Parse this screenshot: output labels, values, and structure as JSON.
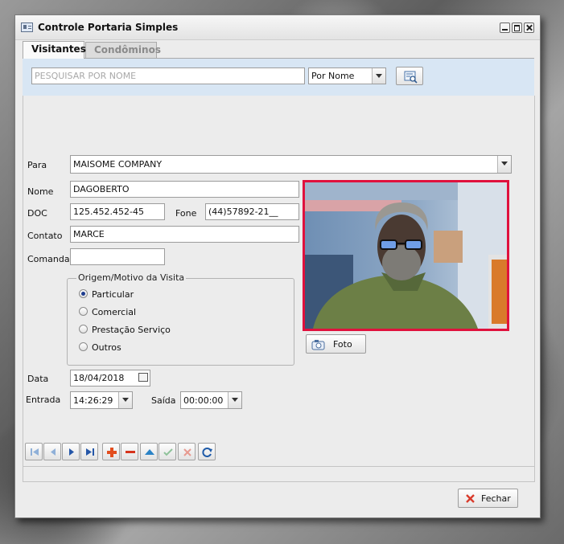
{
  "window": {
    "title": "Controle Portaria Simples"
  },
  "tabs": [
    {
      "label": "Visitantes"
    },
    {
      "label": "Condôminos"
    }
  ],
  "search": {
    "placeholder": "PESQUISAR POR NOME",
    "mode": "Por Nome"
  },
  "form": {
    "para_label": "Para",
    "para_value": "MAISOME COMPANY",
    "nome_label": "Nome",
    "nome_value": "DAGOBERTO",
    "doc_label": "DOC",
    "doc_value": "125.452.452-45",
    "fone_label": "Fone",
    "fone_value": "(44)57892-21__",
    "contato_label": "Contato",
    "contato_value": "MARCE",
    "comanda_label": "Comanda",
    "comanda_value": "",
    "group_title": "Origem/Motivo da Visita",
    "options": [
      {
        "label": "Particular",
        "checked": true
      },
      {
        "label": "Comercial",
        "checked": false
      },
      {
        "label": "Prestação Serviço",
        "checked": false
      },
      {
        "label": "Outros",
        "checked": false
      }
    ],
    "data_label": "Data",
    "data_value": "18/04/2018",
    "entrada_label": "Entrada",
    "entrada_value": "14:26:29",
    "saida_label": "Saída",
    "saida_value": "00:00:00"
  },
  "photo": {
    "button_label": "Foto",
    "border_color": "#e0113d"
  },
  "nav_icons": [
    "first-icon",
    "prior-icon",
    "next-icon",
    "last-icon",
    "insert-icon",
    "delete-icon",
    "edit-icon",
    "post-icon",
    "cancel-icon",
    "refresh-icon"
  ],
  "footer": {
    "close_label": "Fechar"
  }
}
